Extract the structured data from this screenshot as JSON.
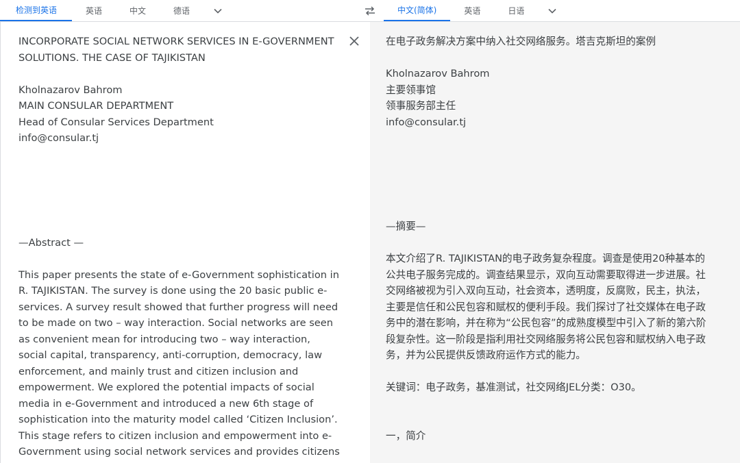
{
  "source_tabs": [
    "检测到英语",
    "英语",
    "中文",
    "德语"
  ],
  "target_tabs": [
    "中文(简体)",
    "英语",
    "日语"
  ],
  "icons": {
    "dropdown": "chevron-down-icon",
    "swap": "swap-icon",
    "close": "close-icon"
  },
  "colors": {
    "accent": "#1a73e8",
    "target_bg": "#f5f5f5"
  },
  "source": {
    "title": "INCORPORATE SOCIAL NETWORK SERVICES IN E-GOVERNMENT SOLUTIONS. THE CASE OF TAJIKISTAN",
    "author_lines": [
      "Kholnazarov Bahrom",
      "MAIN CONSULAR DEPARTMENT",
      "Head of Consular Services Department",
      "info@consular.tj"
    ],
    "abstract_heading": "—Abstract —",
    "abstract_text": "This paper presents the state of e-Government sophistication in R. TAJIKISTAN. The survey is done using the 20 basic public e- services. A survey result showed that further progress will need to be made on two – way interaction. Social networks are seen as convenient mean for introducing two – way interaction, social capital, transparency, anti-corruption, democracy, law enforcement, and mainly trust and citizen inclusion and empowerment. We explored the potential impacts of social media in e-Government and introduced a new 6th stage of sophistication into the maturity model called ‘Citizen Inclusion’. This stage refers to citizen inclusion and empowerment into e-Government using social network services and provides citizens with ability to feed-back on how government operates."
  },
  "target": {
    "title": "在电子政务解决方案中纳入社交网络服务。塔吉克斯坦的案例",
    "author_lines": [
      "Kholnazarov Bahrom",
      "主要领事馆",
      "领事服务部主任",
      "info@consular.tj"
    ],
    "abstract_heading": "—摘要—",
    "abstract_text": "本文介绍了R. TAJIKISTAN的电子政务复杂程度。调查是使用20种基本的公共电子服务完成的。调查结果显示，双向互动需要取得进一步进展。社交网络被视为引入双向互动，社会资本，透明度，反腐败，民主，执法，主要是信任和公民包容和赋权的便利手段。我们探讨了社交媒体在电子政务中的潜在影响，并在称为“公民包容”的成熟度模型中引入了新的第六阶段复杂性。这一阶段是指利用社交网络服务将公民包容和赋权纳入电子政务，并为公民提供反馈政府运作方式的能力。",
    "keywords": "关键词：电子政务，基准测试，社交网络JEL分类：O30。",
    "section_heading": "一，简介"
  }
}
